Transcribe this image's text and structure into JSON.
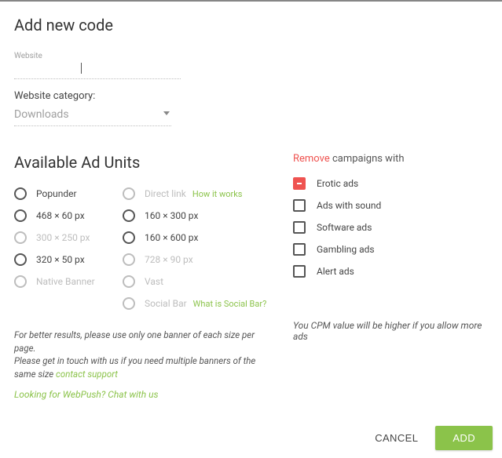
{
  "dialog": {
    "title": "Add new code",
    "website_label": "Website",
    "website_value": "",
    "category_label": "Website category:",
    "category_value": "Downloads"
  },
  "adunits": {
    "title": "Available Ad Units",
    "col1": [
      {
        "label": "Popunder",
        "disabled": false
      },
      {
        "label": "468 × 60 px",
        "disabled": false
      },
      {
        "label": "300 × 250 px",
        "disabled": true
      },
      {
        "label": "320 × 50 px",
        "disabled": false
      },
      {
        "label": "Native Banner",
        "disabled": true
      }
    ],
    "col2": [
      {
        "label": "Direct link",
        "disabled": true,
        "extra": "How it works"
      },
      {
        "label": "160 × 300 px",
        "disabled": false
      },
      {
        "label": "160 × 600 px",
        "disabled": false
      },
      {
        "label": "728 × 90 px",
        "disabled": true
      },
      {
        "label": "Vast",
        "disabled": true
      },
      {
        "label": "Social Bar",
        "disabled": true,
        "extra": "What is Social Bar?"
      }
    ],
    "note1": "For better results, please use only one banner of each size per page.",
    "note2a": "Please get in touch with us if you need multiple banners of the same size ",
    "note2b": "contact support",
    "webpush": "Looking for WebPush? Chat with us"
  },
  "remove": {
    "word": "Remove",
    "rest": " campaigns with",
    "items": [
      {
        "label": "Erotic ads",
        "state": "indet"
      },
      {
        "label": "Ads with sound",
        "state": "off"
      },
      {
        "label": "Software ads",
        "state": "off"
      },
      {
        "label": "Gambling ads",
        "state": "off"
      },
      {
        "label": "Alert ads",
        "state": "off"
      }
    ],
    "cpm": "You CPM value will be higher if you allow more ads"
  },
  "footer": {
    "cancel": "CANCEL",
    "add": "ADD"
  }
}
